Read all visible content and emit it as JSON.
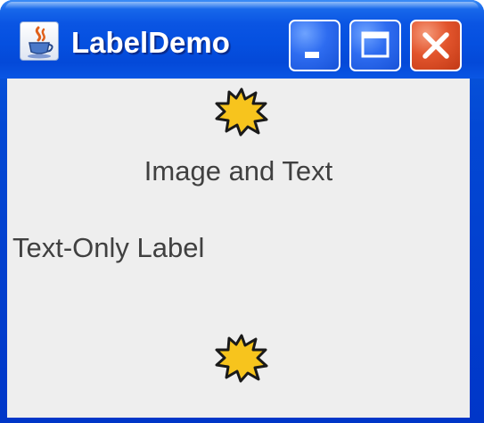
{
  "window": {
    "title": "LabelDemo",
    "app_icon": "java-cup-icon",
    "controls": {
      "minimize_icon": "minimize-icon",
      "maximize_icon": "maximize-icon",
      "close_icon": "close-icon"
    }
  },
  "labels": {
    "image_and_text": {
      "text": "Image and Text",
      "icon": "star-burst-icon"
    },
    "text_only": {
      "text": "Text-Only Label"
    },
    "icon_only": {
      "icon": "star-burst-icon"
    }
  },
  "colors": {
    "titlebar": "#0550e0",
    "content_bg": "#eeeeee",
    "label_text": "#404040",
    "star_fill": "#f7c41d",
    "close_button": "#e2542c"
  }
}
